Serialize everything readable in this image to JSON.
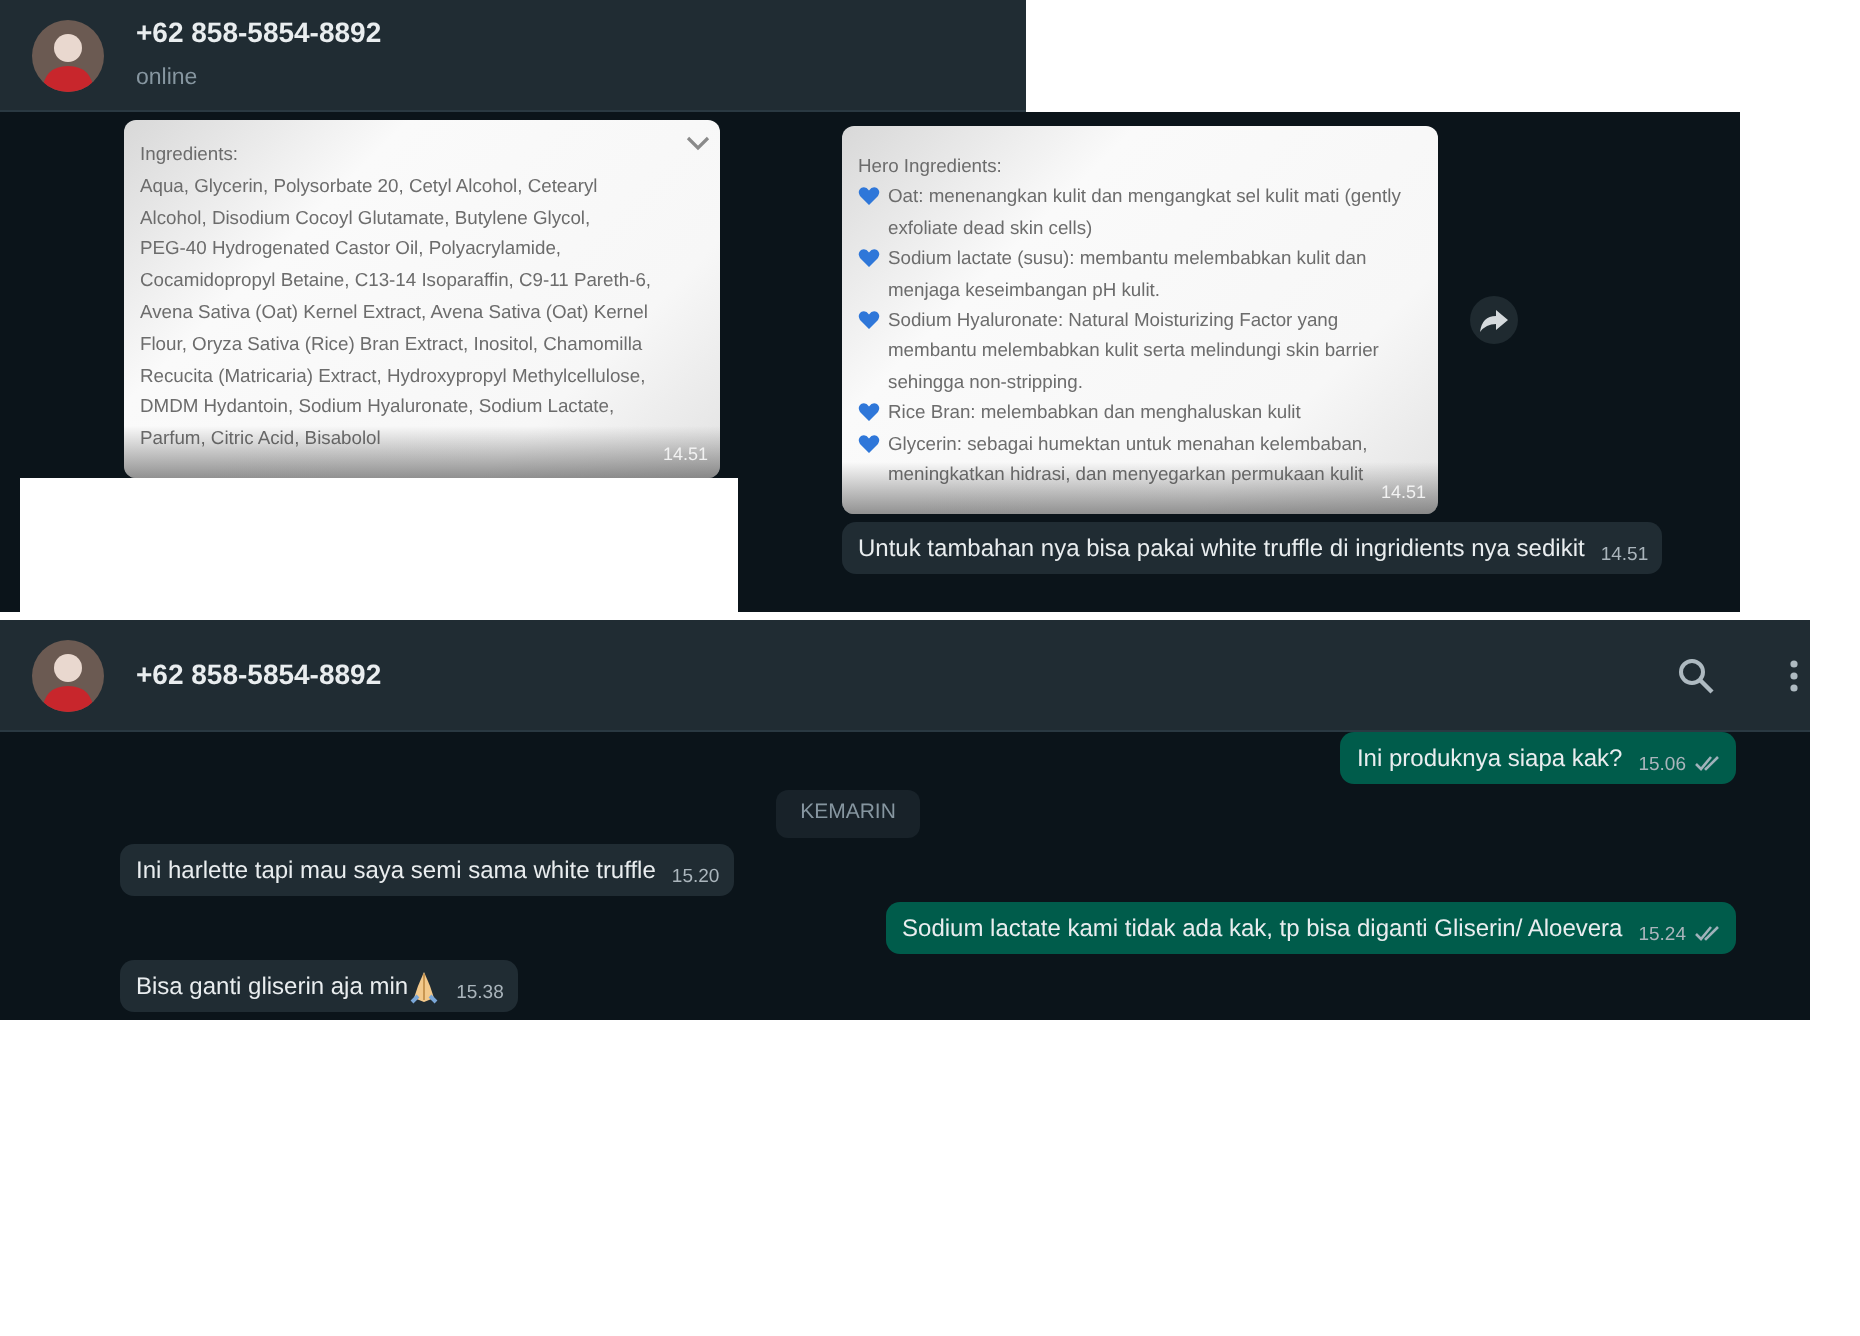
{
  "top_chat": {
    "header": {
      "contact": "+62 858-5854-8892",
      "status": "online"
    },
    "left_messages": [
      {
        "kind": "ingredients_image",
        "heading": "Ingredients:",
        "lines": [
          "Aqua, Glycerin, Polysorbate 20, Cetyl Alcohol, Cetearyl",
          "Alcohol, Disodium Cocoyl Glutamate, Butylene Glycol,",
          "PEG-40 Hydrogenated Castor Oil, Polyacrylamide,",
          "Cocamidopropyl Betaine, C13-14 Isoparaffin, C9-11 Pareth-6,",
          "Avena Sativa (Oat) Kernel Extract, Avena Sativa (Oat) Kernel",
          "Flour, Oryza Sativa (Rice) Bran Extract, Inositol, Chamomilla",
          "Recucita (Matricaria) Extract, Hydroxypropyl Methylcellulose,",
          "DMDM Hydantoin, Sodium Hyaluronate, Sodium Lactate,",
          "Parfum, Citric Acid, Bisabolol"
        ],
        "time": "14.51"
      }
    ],
    "right_messages": [
      {
        "kind": "hero_image",
        "heading": "Hero Ingredients:",
        "items": [
          "Oat: menenangkan kulit dan mengangkat sel kulit mati (gently exfoliate dead skin cells)",
          "Sodium lactate (susu): membantu melembabkan kulit dan menjaga keseimbangan pH kulit.",
          "Sodium Hyaluronate: Natural Moisturizing Factor yang membantu melembabkan kulit serta melindungi skin barrier sehingga non-stripping.",
          "Rice Bran: melembabkan dan menghaluskan kulit",
          "Glycerin: sebagai humektan untuk menahan kelembaban, meningkatkan hidrasi, dan menyegarkan permukaan kulit"
        ],
        "time": "14.51"
      },
      {
        "kind": "text",
        "outgoing": false,
        "text": "Untuk tambahan nya bisa pakai white truffle di ingridients nya sedikit",
        "time": "14.51"
      }
    ]
  },
  "bottom_chat": {
    "header": {
      "contact": "+62 858-5854-8892"
    },
    "messages": [
      {
        "kind": "text",
        "outgoing": true,
        "text": "Ini produknya siapa kak?",
        "time": "15.06",
        "delivered": true
      },
      {
        "kind": "date",
        "text": "KEMARIN"
      },
      {
        "kind": "text",
        "outgoing": false,
        "text": "Ini harlette tapi mau saya semi sama white truffle",
        "time": "15.20"
      },
      {
        "kind": "text",
        "outgoing": true,
        "text": "Sodium lactate kami tidak ada kak, tp bisa diganti Gliserin/ Aloevera",
        "time": "15.24",
        "delivered": true
      },
      {
        "kind": "text_emoji",
        "outgoing": false,
        "text": "Bisa ganti gliserin aja min",
        "time": "15.38"
      }
    ]
  }
}
